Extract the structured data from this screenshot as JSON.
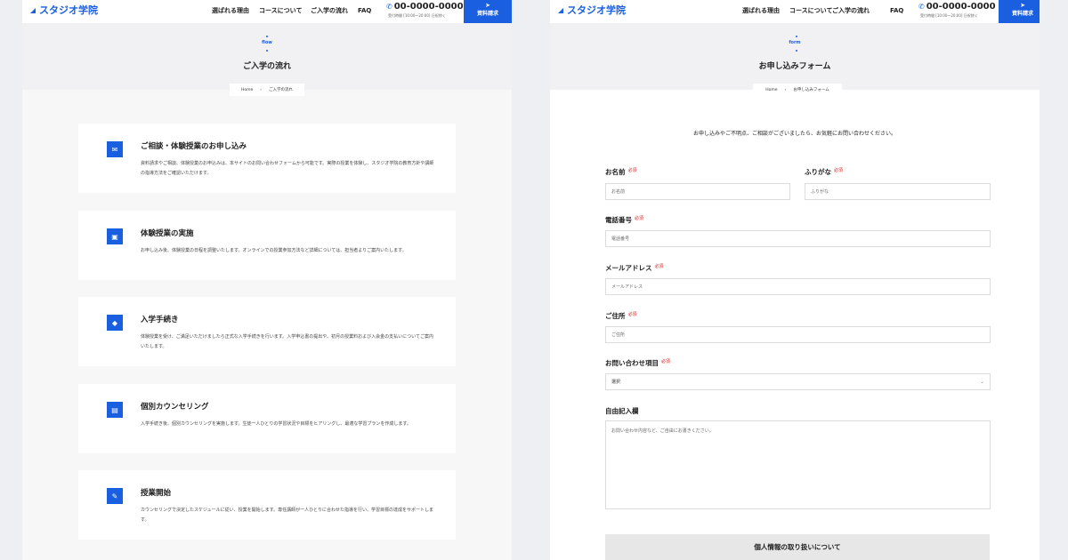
{
  "header": {
    "logo": "スタジオ学院",
    "nav": [
      "選ばれる理由",
      "コースについて",
      "ご入学の流れ",
      "FAQ"
    ],
    "phone": "00-0000-0000",
    "hours": "受付時間 [10:00〜20:00] 日祝除く",
    "cta": "資料請求"
  },
  "flow_page": {
    "label": "flow",
    "title": "ご入学の流れ",
    "breadcrumb": {
      "home": "Home",
      "current": "ご入学の流れ"
    },
    "steps": [
      {
        "title": "ご相談・体験授業のお申し込み",
        "desc": "資料請求やご相談、体験授業のお申込みは、本サイトのお問い合わせフォームから可能です。実際の授業を体験し、スタジオ学院の教育方針や講師の指導方法をご確認いただけます。"
      },
      {
        "title": "体験授業の実施",
        "desc": "お申し込み後、体験授業の日程を調整いたします。オンラインでの授業参加方法など詳細については、担当者よりご案内いたします。"
      },
      {
        "title": "入学手続き",
        "desc": "体験授業を受け、ご満足いただけましたら正式な入学手続きを行います。入学申込書の提出や、初月の授業料および入会金の支払いについてご案内いたします。"
      },
      {
        "title": "個別カウンセリング",
        "desc": "入学手続き後、個別カウンセリングを実施します。生徒一人ひとりの学習状況や目標をヒアリングし、最適な学習プランを作成します。"
      },
      {
        "title": "授業開始",
        "desc": "カウンセリングで決定したスケジュールに従い、授業を開始します。専任講師が一人ひとりに合わせた指導を行い、学習目標の達成をサポートします。"
      }
    ]
  },
  "form_page": {
    "label": "form",
    "title": "お申し込みフォーム",
    "breadcrumb": {
      "home": "Home",
      "current": "お申し込みフォーム"
    },
    "intro": "お申し込みやご不明点、ご相談がございましたら、お気軽にお問い合わせください。",
    "required": "必須",
    "fields": {
      "name": {
        "label": "お名前",
        "placeholder": "お名前"
      },
      "furigana": {
        "label": "ふりがな",
        "placeholder": "ふりがな"
      },
      "phone": {
        "label": "電話番号",
        "placeholder": "電話番号"
      },
      "email": {
        "label": "メールアドレス",
        "placeholder": "メールアドレス"
      },
      "address": {
        "label": "ご住所",
        "placeholder": "ご住所"
      },
      "inquiry": {
        "label": "お問い合わせ項目",
        "value": "選択"
      },
      "message": {
        "label": "自由記入欄",
        "placeholder": "お問い合わせ内容など、ご自由にお書きください。"
      }
    },
    "privacy": "個人情報の取り扱いについて"
  },
  "colors": {
    "accent": "#1a5fe0",
    "required": "#e02020"
  }
}
